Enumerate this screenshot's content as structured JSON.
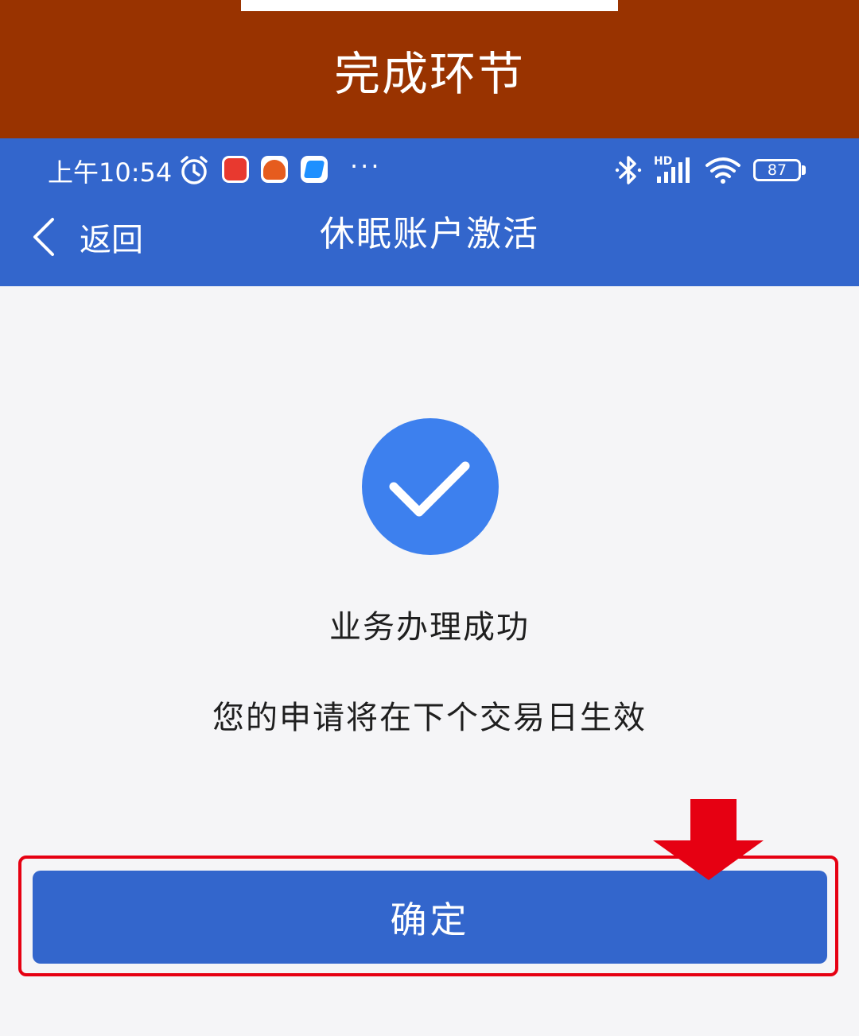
{
  "banner": {
    "title": "完成环节",
    "color": "#993300"
  },
  "status_bar": {
    "time": "上午10:54",
    "icons": [
      "alarm-icon",
      "toutiao-app-icon",
      "fanqie-app-icon",
      "dingtalk-app-icon",
      "more-dots-icon",
      "bluetooth-icon",
      "signal-icon",
      "wifi-icon",
      "battery-icon"
    ],
    "more": "···",
    "network_label": "HD",
    "battery_level": "87"
  },
  "nav": {
    "back_label": "返回",
    "title": "休眠账户激活",
    "color": "#3366cc"
  },
  "result": {
    "icon": "check-icon",
    "title": "业务办理成功",
    "message": "您的申请将在下个交易日生效",
    "icon_color": "#3d80ee"
  },
  "actions": {
    "confirm_label": "确定",
    "highlight_color": "#e60012"
  }
}
